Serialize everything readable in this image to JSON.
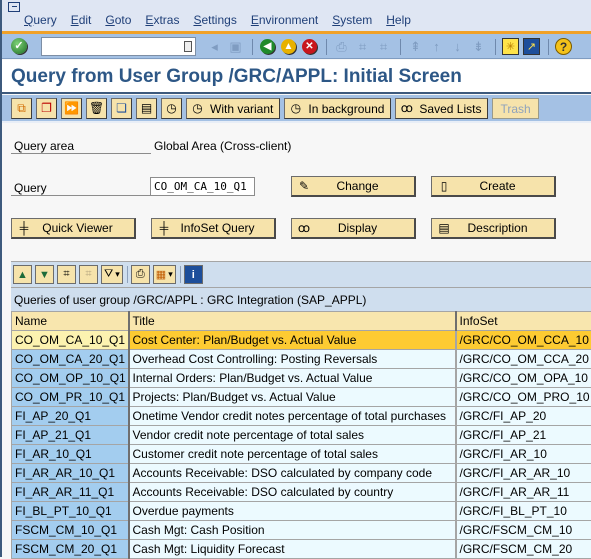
{
  "menubar": {
    "items": [
      "Query",
      "Edit",
      "Goto",
      "Extras",
      "Settings",
      "Environment",
      "System",
      "Help"
    ]
  },
  "std_toolbar": {
    "command_field_value": "",
    "icons": [
      "enter-icon",
      "command-dropdown-icon",
      "back-triangle-icon",
      "save-icon",
      "back-icon",
      "exit-icon",
      "cancel-icon",
      "print-icon",
      "find-icon",
      "find-next-icon",
      "first-page-icon",
      "previous-page-icon",
      "next-page-icon",
      "last-page-icon",
      "create-session-icon",
      "shortcut-icon",
      "help-icon"
    ]
  },
  "title": "Query from User Group /GRC/APPL: Initial Screen",
  "app_toolbar": {
    "icon_buttons": [
      "other-user-group-icon",
      "copy-icon",
      "execute-icon",
      "delete-icon",
      "infoset-icon",
      "display-screen-icon",
      "execute-clock-icon"
    ],
    "with_variant": "With variant",
    "in_background": "In background",
    "saved_lists": "Saved Lists",
    "trash": "Trash"
  },
  "form": {
    "query_area_label": "Query area",
    "query_area_value": "Global Area (Cross-client)",
    "query_label": "Query",
    "query_value": "CO_OM_CA_10_Q1",
    "change": "Change",
    "create": "Create",
    "quick_viewer": "Quick Viewer",
    "infoset_query": "InfoSet Query",
    "display": "Display",
    "description": "Description"
  },
  "grid": {
    "title": "Queries of user group /GRC/APPL : GRC Integration (SAP_APPL)",
    "columns": [
      "Name",
      "Title",
      "InfoSet"
    ],
    "selected_index": 0,
    "rows": [
      {
        "name": "CO_OM_CA_10_Q1",
        "title": "Cost Center: Plan/Budget vs. Actual Value",
        "infoset": "/GRC/CO_OM_CCA_10"
      },
      {
        "name": "CO_OM_CA_20_Q1",
        "title": "Overhead Cost Controlling: Posting Reversals",
        "infoset": "/GRC/CO_OM_CCA_20"
      },
      {
        "name": "CO_OM_OP_10_Q1",
        "title": "Internal Orders: Plan/Budget vs. Actual Value",
        "infoset": "/GRC/CO_OM_OPA_10"
      },
      {
        "name": "CO_OM_PR_10_Q1",
        "title": "Projects: Plan/Budget vs. Actual Value",
        "infoset": "/GRC/CO_OM_PRO_10"
      },
      {
        "name": "FI_AP_20_Q1",
        "title": "Onetime Vendor credit notes percentage of total purchases",
        "infoset": "/GRC/FI_AP_20"
      },
      {
        "name": "FI_AP_21_Q1",
        "title": "Vendor credit note percentage of total sales",
        "infoset": "/GRC/FI_AP_21"
      },
      {
        "name": "FI_AR_10_Q1",
        "title": "Customer credit note percentage of total sales",
        "infoset": "/GRC/FI_AR_10"
      },
      {
        "name": "FI_AR_AR_10_Q1",
        "title": "Accounts Receivable: DSO calculated by company code",
        "infoset": "/GRC/FI_AR_AR_10"
      },
      {
        "name": "FI_AR_AR_11_Q1",
        "title": "Accounts Receivable: DSO calculated by country",
        "infoset": "/GRC/FI_AR_AR_11"
      },
      {
        "name": "FI_BL_PT_10_Q1",
        "title": "Overdue payments",
        "infoset": "/GRC/FI_BL_PT_10"
      },
      {
        "name": "FSCM_CM_10_Q1",
        "title": "Cash Mgt: Cash Position",
        "infoset": "/GRC/FSCM_CM_10"
      },
      {
        "name": "FSCM_CM_20_Q1",
        "title": "Cash Mgt: Liquidity Forecast",
        "infoset": "/GRC/FSCM_CM_20"
      }
    ]
  }
}
